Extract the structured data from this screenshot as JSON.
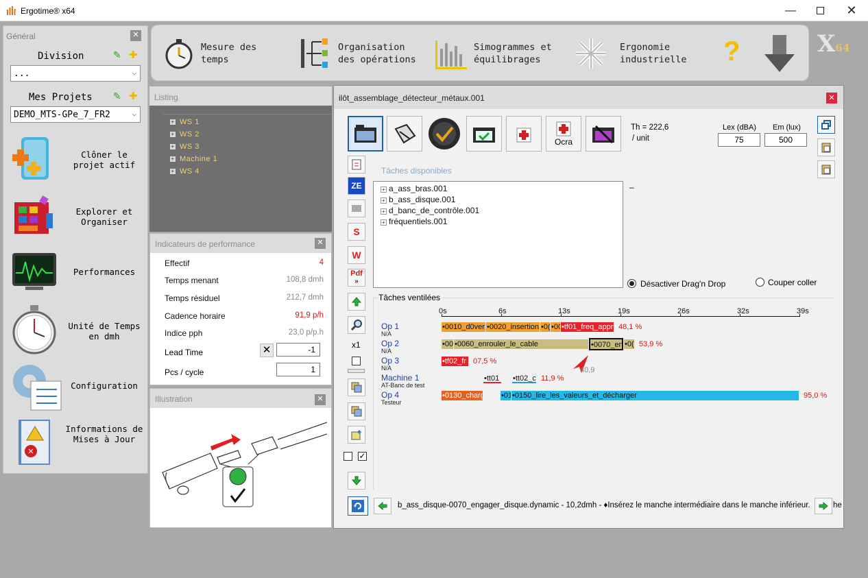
{
  "window": {
    "title": "Ergotime® x64",
    "icon": "bar-chart-icon",
    "controls": [
      "minimize-icon",
      "maximize-icon",
      "close-icon"
    ]
  },
  "toolbar": {
    "items": [
      {
        "icon": "stopwatch-icon",
        "label1": "Mesure des",
        "label2": "temps"
      },
      {
        "icon": "org-chart-icon",
        "label1": "Organisation",
        "label2": "des opérations"
      },
      {
        "icon": "bar-chart-icon",
        "label1": "Simogrammes et",
        "label2": "équilibrages"
      },
      {
        "icon": "snowflake-icon",
        "label1": "Ergonomie",
        "label2": "industrielle"
      }
    ],
    "help": "?",
    "logo": "X",
    "logo_sub": "64"
  },
  "general": {
    "title": "Général",
    "division_label": "Division",
    "division_value": "...",
    "projects_label": "Mes Projets",
    "projects_value": "DEMO_MTS-GPe_7_FR2",
    "buttons": [
      {
        "icon": "clone-icon",
        "label": "Clôner le projet actif"
      },
      {
        "icon": "explore-icon",
        "label": "Explorer et Organiser"
      },
      {
        "icon": "monitor-icon",
        "label": "Performances"
      },
      {
        "icon": "stopwatch-icon",
        "label": "Unité de Temps en dmh"
      },
      {
        "icon": "gear-icon",
        "label": "Configuration"
      },
      {
        "icon": "notebook-icon",
        "label": "Informations de Mises à Jour"
      }
    ]
  },
  "listing": {
    "title": "Listing",
    "items": [
      "WS 1",
      "WS 2",
      "WS 3",
      "Machine 1",
      "WS 4"
    ]
  },
  "perf": {
    "title": "Indicateurs de performance",
    "rows": [
      {
        "label": "Effectif",
        "value": "4",
        "color": "#e01010"
      },
      {
        "label": "Temps menant",
        "value": "108,8 dmh"
      },
      {
        "label": "Temps résiduel",
        "value": "212,7 dmh"
      },
      {
        "label": "Cadence horaire",
        "value": "91,9 p/h",
        "color": "#e01010"
      },
      {
        "label": "Indice pph",
        "value": "23,0 p/p.h"
      }
    ],
    "lead_time_label": "Lead Time",
    "lead_time_value": "-1",
    "pcs_label": "Pcs / cycle",
    "pcs_value": "1"
  },
  "illustration": {
    "title": "Illustration"
  },
  "doc": {
    "title": "ilôt_assemblage_détecteur_métaux.001",
    "ocra": "Ocra",
    "th": "Th = 222,6",
    "unit": "/ unit",
    "lex_label": "Lex (dBA)",
    "lex_value": "75",
    "em_label": "Em (lux)",
    "em_value": "500",
    "available_label": "Tâches disponibles",
    "tree": [
      "a_ass_bras.001",
      "b_ass_disque.001",
      "d_banc_de_contrôle.001",
      "fréquentiels.001"
    ],
    "dash": "–",
    "radio1": "Désactiver Drag'n Drop",
    "radio2": "Couper coller",
    "vent_label": "Tâches ventilées",
    "zoom": "x1",
    "side_pdf": "Pdf",
    "side_s": "S",
    "side_w": "W",
    "ticks": [
      "0s",
      "6s",
      "13s",
      "19s",
      "26s",
      "32s",
      "39s"
    ],
    "ops": [
      {
        "name": "Op 1",
        "sub": "N/A",
        "pct": "48,1 %"
      },
      {
        "name": "Op 2",
        "sub": "N/A",
        "pct": "53,9 %"
      },
      {
        "name": "Op 3",
        "sub": "N/A",
        "pct": "07,5 %"
      },
      {
        "name": "Machine 1",
        "sub": "AT-Banc de test",
        "pct": "11,9 %"
      },
      {
        "name": "Op 4",
        "sub": "Testeur",
        "pct": "95,0 %"
      }
    ],
    "bars": {
      "op1": [
        "•0010_d0ver",
        "•0020_insertion",
        "•0(",
        "•00",
        "•tf01_freq_appr"
      ],
      "op2": [
        "•00",
        "•0060_enrouler_le_cable",
        "•0070_en",
        "•0("
      ],
      "op3": [
        "•tf02_fr"
      ],
      "m1": [
        "•tt01",
        "•tt02_c"
      ],
      "op4": [
        "•0130_charg",
        "•01",
        "•0150_lire_les_valeurs_et_décharger"
      ]
    },
    "marker": "40,9",
    "status": "b_ass_disque-0070_engager_disque.dynamic - 10,2dmh - ♦Insérez le manche intermédiaire dans le manche inférieur. ☻Le",
    "status_tail": "he"
  }
}
